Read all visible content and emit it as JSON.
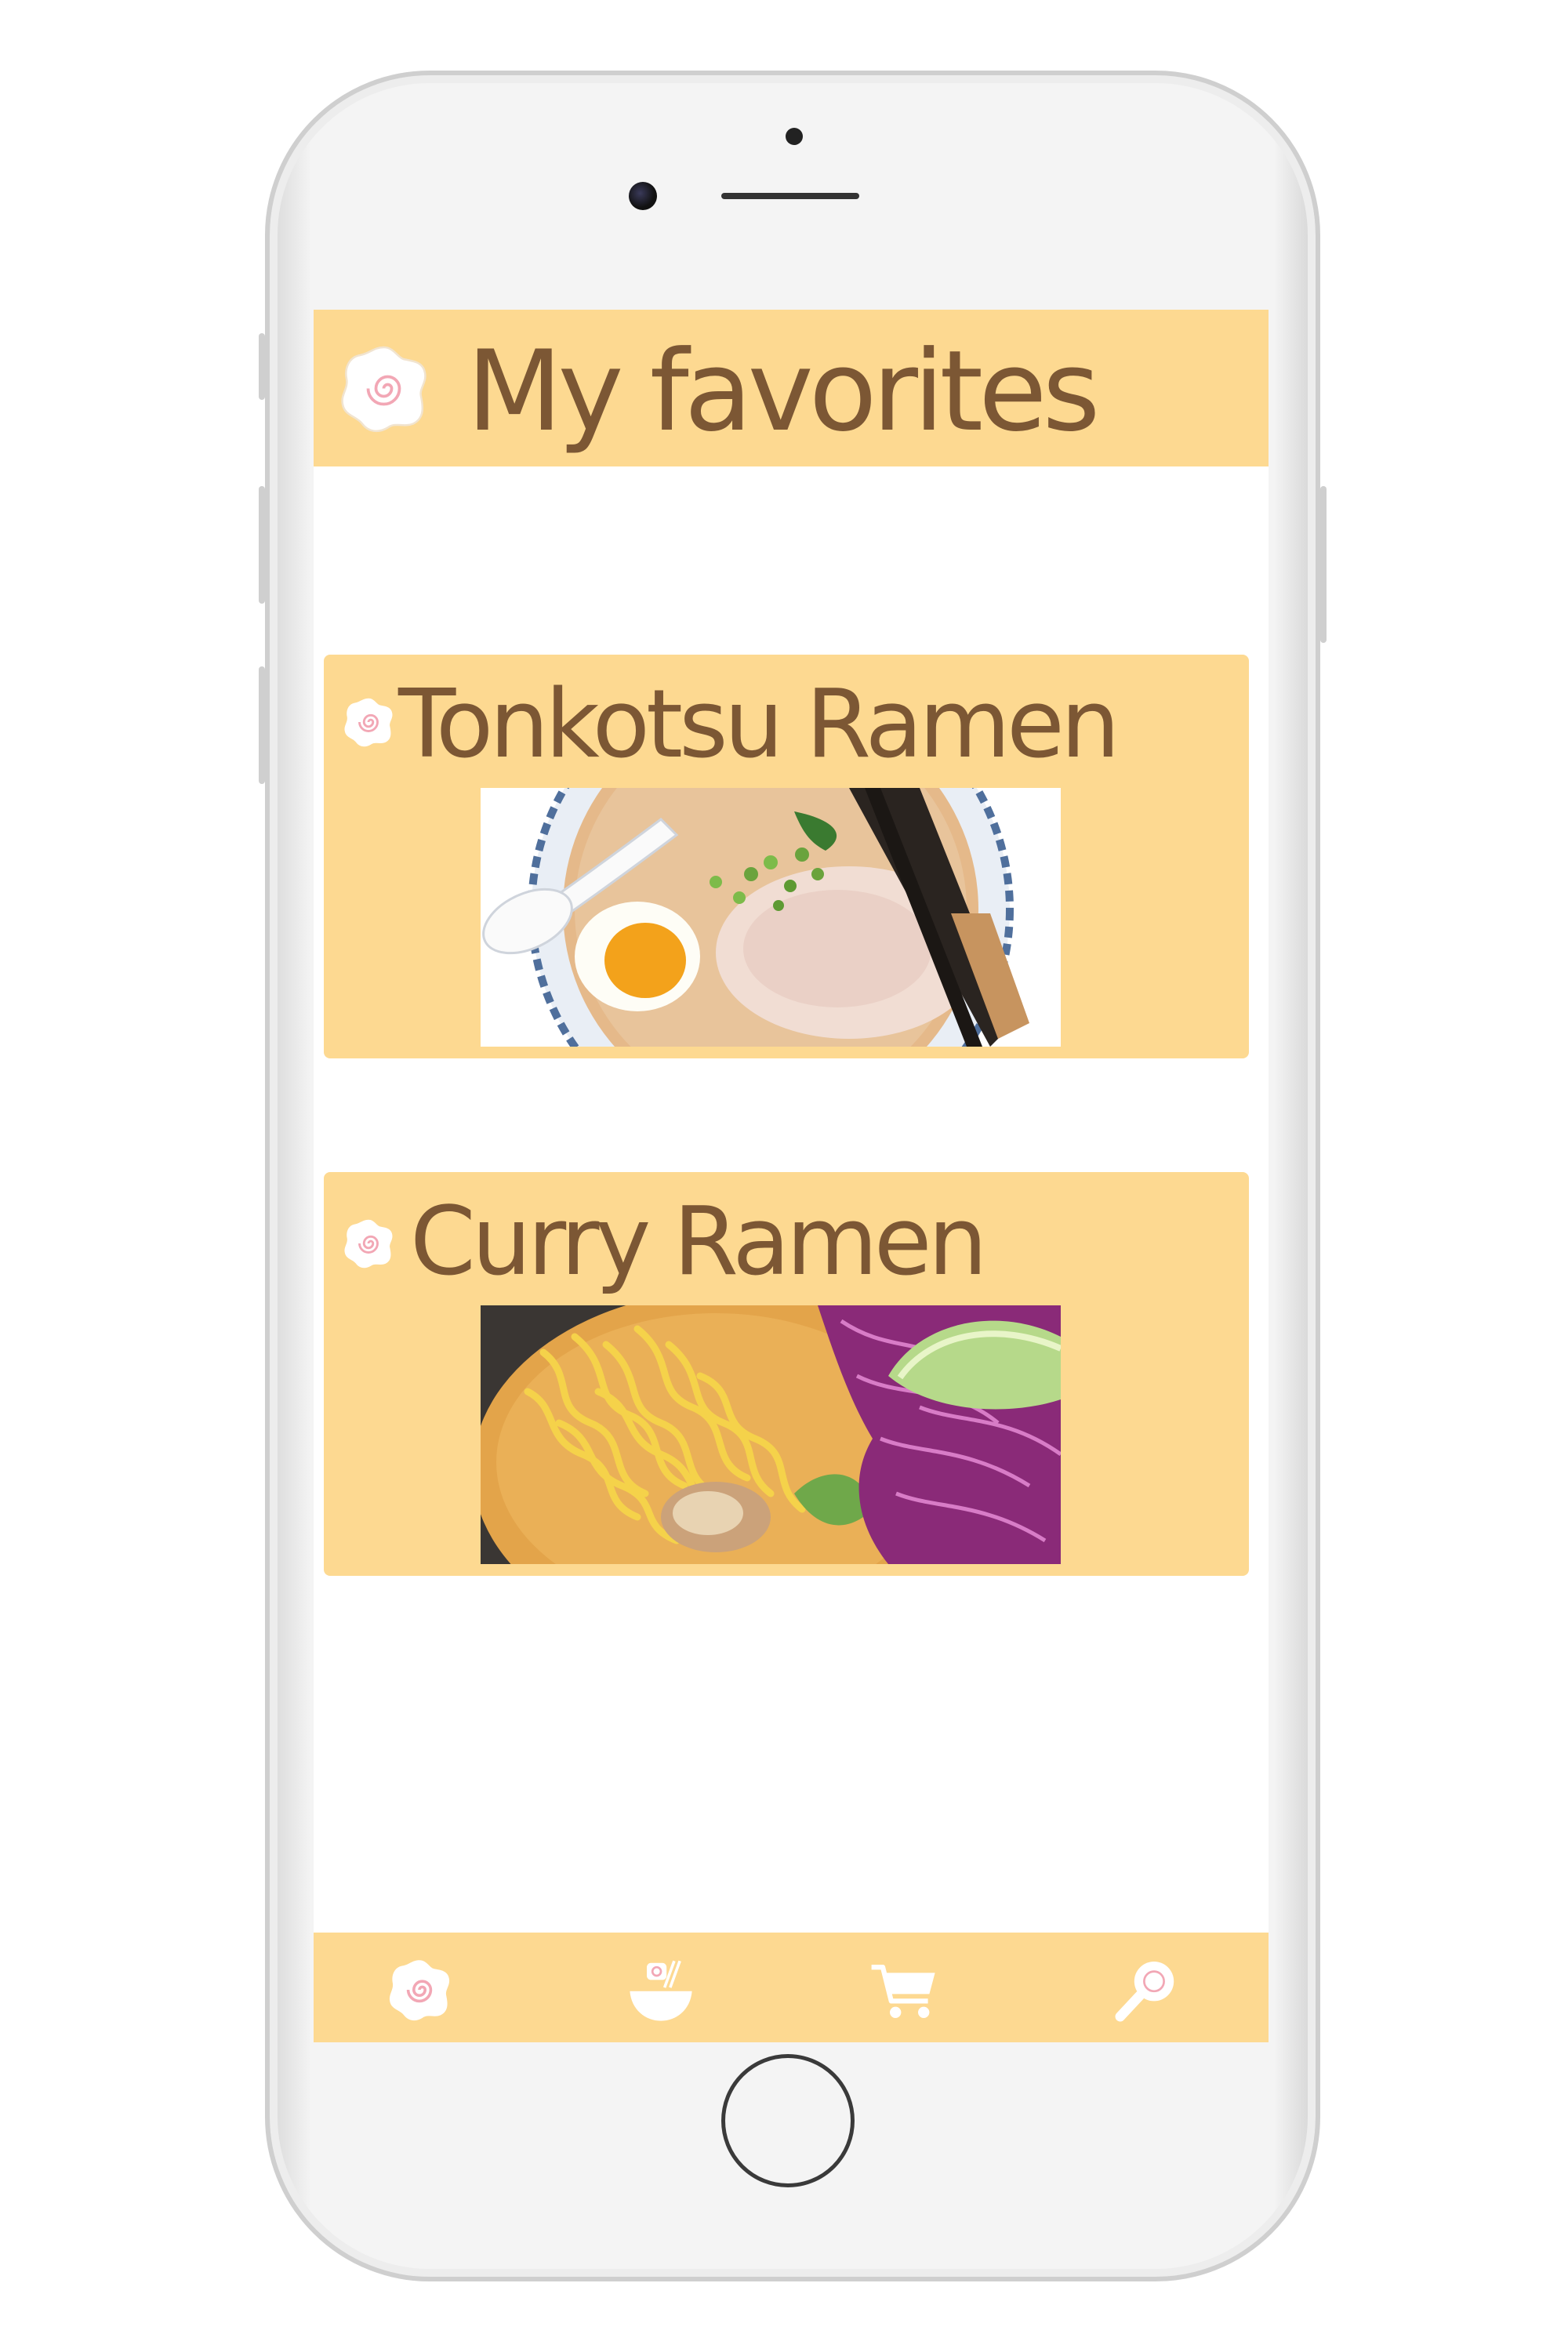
{
  "header": {
    "title": "My favorites",
    "icon": "narutomaki-icon"
  },
  "favorites": [
    {
      "title": "Tonkotsu Ramen",
      "icon": "narutomaki-icon",
      "image": "tonkotsu-ramen-photo"
    },
    {
      "title": "Curry Ramen",
      "icon": "narutomaki-icon",
      "image": "curry-ramen-photo"
    }
  ],
  "nav": [
    {
      "id": "home",
      "icon": "narutomaki-icon"
    },
    {
      "id": "menu",
      "icon": "ramen-bowl-icon"
    },
    {
      "id": "cart",
      "icon": "cart-icon"
    },
    {
      "id": "search",
      "icon": "search-icon"
    }
  ],
  "colors": {
    "accent": "#fdd991",
    "text": "#7c5734",
    "narutoSwirl": "#f2a7b5"
  }
}
